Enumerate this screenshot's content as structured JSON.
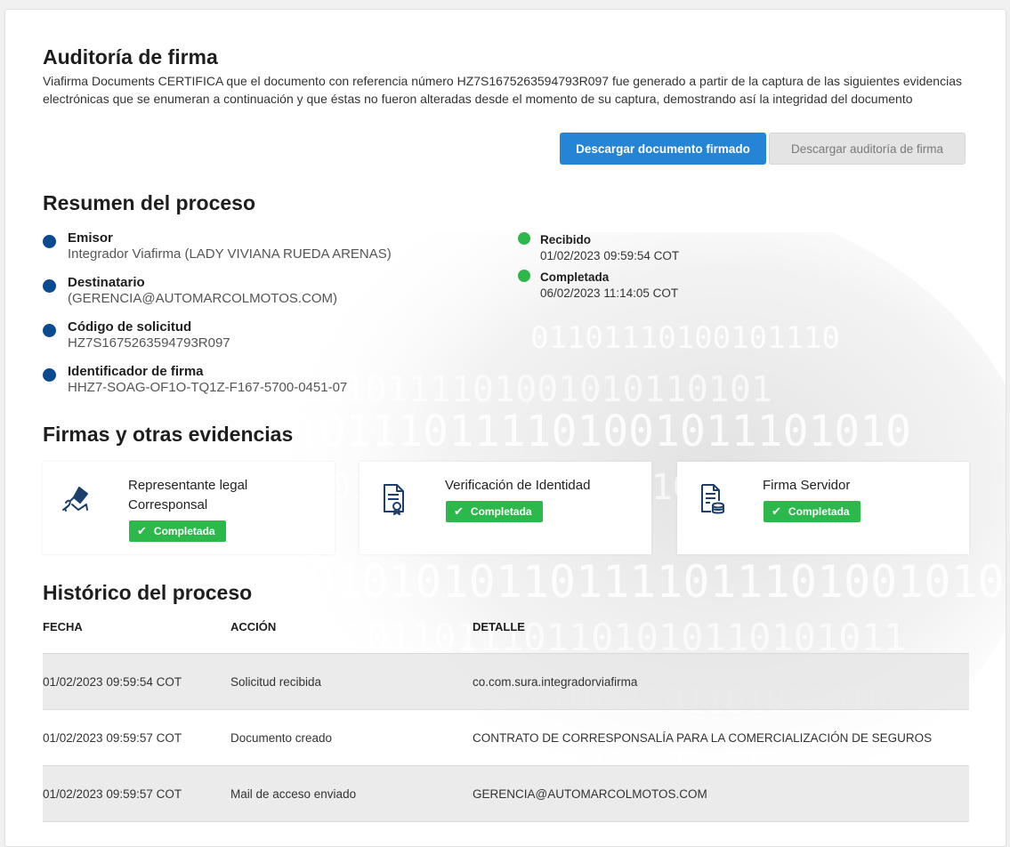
{
  "header": {
    "title": "Auditoría de firma",
    "description": "Viafirma Documents CERTIFICA que el documento con referencia número HZ7S1675263594793R097 fue generado a partir de la captura de las siguientes evidencias electrónicas que se enumeran a continuación y que éstas no fueron alteradas desde el momento de su captura, demostrando así la integridad del documento"
  },
  "actions": {
    "download_signed": "Descargar documento firmado",
    "download_audit": "Descargar auditoría de firma"
  },
  "summary": {
    "heading": "Resumen del proceso",
    "items": [
      {
        "label": "Emisor",
        "value": "Integrador Viafirma (LADY VIVIANA RUEDA ARENAS)"
      },
      {
        "label": "Destinatario",
        "value": "(GERENCIA@AUTOMARCOLMOTOS.COM)"
      },
      {
        "label": "Código de solicitud",
        "value": "HZ7S1675263594793R097"
      },
      {
        "label": "Identificador de firma",
        "value": "HHZ7-SOAG-OF1O-TQ1Z-F167-5700-0451-07"
      }
    ],
    "status": [
      {
        "label": "Recibido",
        "value": "01/02/2023 09:59:54 COT"
      },
      {
        "label": "Completada",
        "value": "06/02/2023 11:14:05 COT"
      }
    ],
    "colors": {
      "item_dot": "#0c4a8f",
      "status_dot": "#2db84c"
    }
  },
  "evidences": {
    "heading": "Firmas y otras evidencias",
    "cards": [
      {
        "icon": "signature-hand-icon",
        "title_line1": "Representante legal",
        "title_line2": "Corresponsal",
        "badge": "Completada"
      },
      {
        "icon": "certificate-document-icon",
        "title_line1": "Verificación de Identidad",
        "badge": "Completada"
      },
      {
        "icon": "server-document-icon",
        "title_line1": "Firma Servidor",
        "badge": "Completada"
      }
    ],
    "badge_color": "#2db84c"
  },
  "history": {
    "heading": "Histórico del proceso",
    "columns": [
      "FECHA",
      "ACCIÓN",
      "DETALLE"
    ],
    "rows": [
      [
        "01/02/2023 09:59:54 COT",
        "Solicitud recibida",
        "co.com.sura.integradorviafirma"
      ],
      [
        "01/02/2023 09:59:57 COT",
        "Documento creado",
        "CONTRATO DE CORRESPONSALÍA PARA LA COMERCIALIZACIÓN DE SEGUROS"
      ],
      [
        "01/02/2023 09:59:57 COT",
        "Mail de acceso enviado",
        "GERENCIA@AUTOMARCOLMOTOS.COM"
      ]
    ]
  },
  "theme": {
    "primary": "#2584d4",
    "secondary_bg": "#e4e4e4",
    "heading_color": "#1e1e1e"
  }
}
